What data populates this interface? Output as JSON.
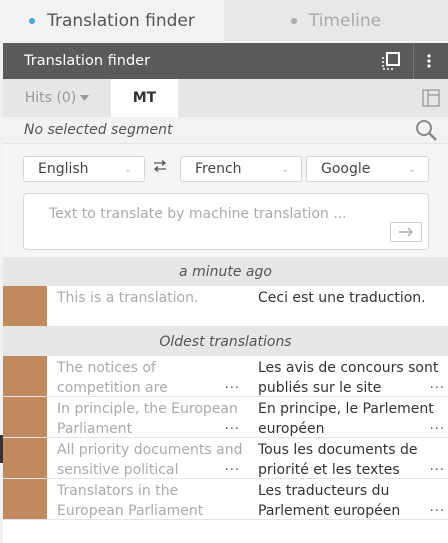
{
  "top_tabs": [
    {
      "label": "Translation finder"
    },
    {
      "label": "Timeline"
    }
  ],
  "panel": {
    "title": "Translation finder",
    "icons": {
      "maximize": "maximize-icon",
      "menu": "kebab-menu-icon",
      "layout": "layout-panel-icon",
      "search": "search-icon",
      "swap": "swap-icon",
      "send": "arrow-right-icon"
    },
    "sub_tabs": {
      "hits": "Hits (0)",
      "mt": "MT"
    },
    "status": "No selected segment",
    "source_lang": "English",
    "target_lang": "French",
    "engine": "Google",
    "text_placeholder": "Text to translate by machine translation ...",
    "recent_header": "a minute ago",
    "recent": [
      {
        "source": "This is a translation.",
        "target": "Ceci est une traduction."
      }
    ],
    "oldest_header": "Oldest translations",
    "oldest": [
      {
        "source": "The notices of competition are",
        "target": "Les avis de concours sont publiés sur le site"
      },
      {
        "source": "In principle, the European Parliament",
        "target": "En principe, le Parlement européen"
      },
      {
        "source": "All priority documents and sensitive political",
        "target": "Tous les documents de priorité et les textes"
      },
      {
        "source": "Translators in the European Parliament",
        "target": "Les traducteurs du Parlement européen"
      }
    ],
    "ellipsis": "..."
  },
  "colors": {
    "accent": "#3fa9d9",
    "header": "#5a5a5a",
    "swatch": "#c08a5c"
  }
}
